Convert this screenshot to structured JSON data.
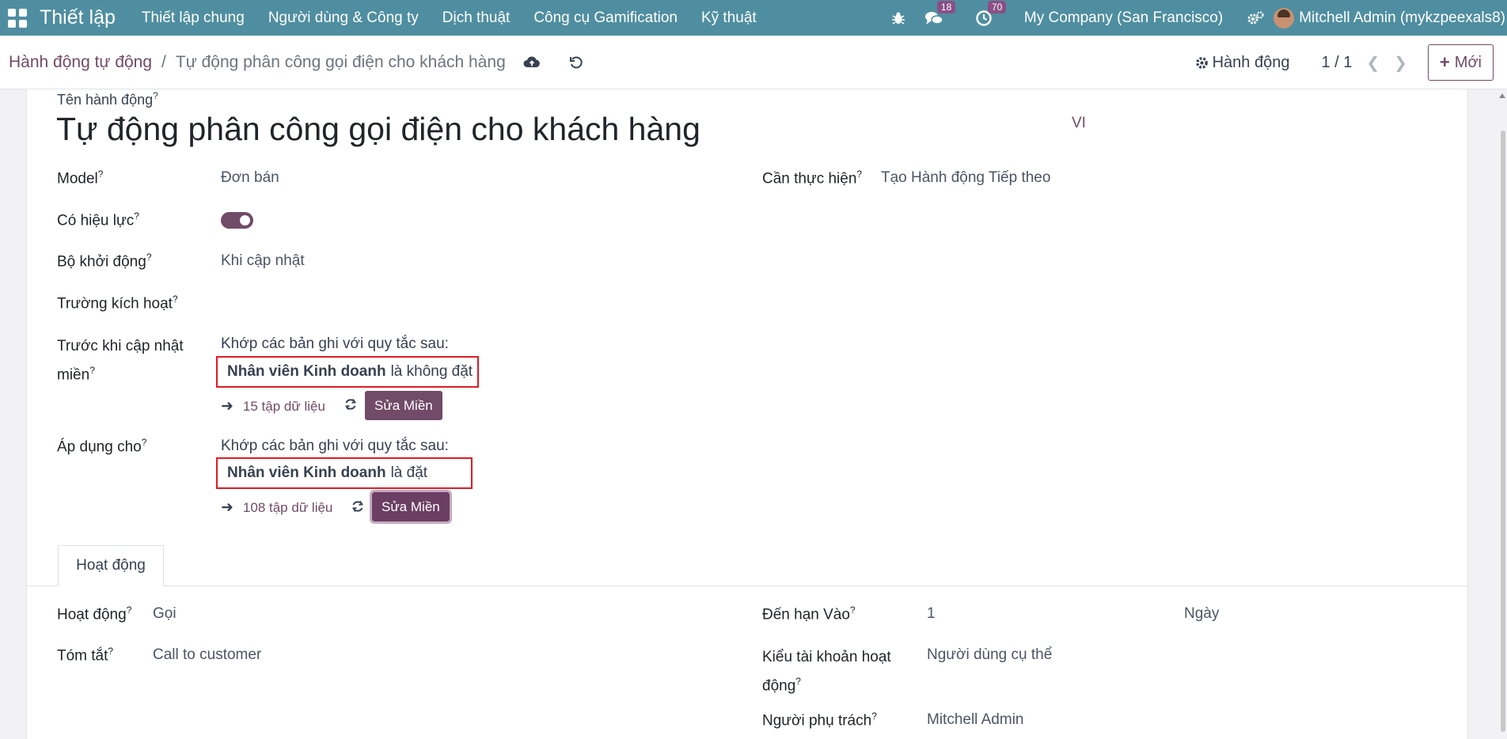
{
  "navbar": {
    "brand": "Thiết lập",
    "menu": [
      "Thiết lập chung",
      "Người dùng & Công ty",
      "Dịch thuật",
      "Công cụ Gamification",
      "Kỹ thuật"
    ],
    "messages_badge": "18",
    "activities_badge": "70",
    "company": "My Company (San Francisco)",
    "user": "Mitchell Admin (mykzpeexals8)"
  },
  "breadcrumb": {
    "parent": "Hành động tự động",
    "separator": "/",
    "current": "Tự động phân công gọi điện cho khách hàng"
  },
  "control": {
    "action_label": "Hành động",
    "pager": "1 / 1",
    "new_label": "Mới"
  },
  "form": {
    "name_label": "Tên hành động",
    "name_value": "Tự động phân công gọi điện cho khách hàng",
    "lang": "VI",
    "help_mark": "?",
    "model_label": "Model",
    "model_value": "Đơn bán",
    "active_label": "Có hiệu lực",
    "active": true,
    "trigger_label": "Bộ khởi động",
    "trigger_value": "Khi cập nhật",
    "trigger_fields_label": "Trường kích hoạt",
    "before_domain_label_1": "Trước khi cập nhật",
    "before_domain_label_2": "miền",
    "domain_intro": "Khớp các bản ghi với quy tắc sau:",
    "before_domain_field": "Nhân viên Kinh doanh",
    "before_domain_op": "là không đặt",
    "before_records": "15 tập dữ liệu",
    "edit_domain": "Sửa Miền",
    "apply_label": "Áp dụng cho",
    "apply_domain_field": "Nhân viên Kinh doanh",
    "apply_domain_op": "là đặt",
    "apply_records": "108 tập dữ liệu",
    "todo_label": "Cần thực hiện",
    "todo_value": "Tạo Hành động Tiếp theo"
  },
  "tab": {
    "label": "Hoạt động"
  },
  "activity": {
    "type_label": "Hoạt động",
    "type_value": "Gọi",
    "summary_label": "Tóm tắt",
    "summary_value": "Call to customer",
    "due_label": "Đến hạn Vào",
    "due_value": "1",
    "due_unit": "Ngày",
    "user_type_label_1": "Kiểu tài khoản hoạt",
    "user_type_label_2": "động",
    "user_type_value": "Người dùng cụ thể",
    "responsible_label": "Người phụ trách",
    "responsible_value": "Mitchell Admin"
  }
}
